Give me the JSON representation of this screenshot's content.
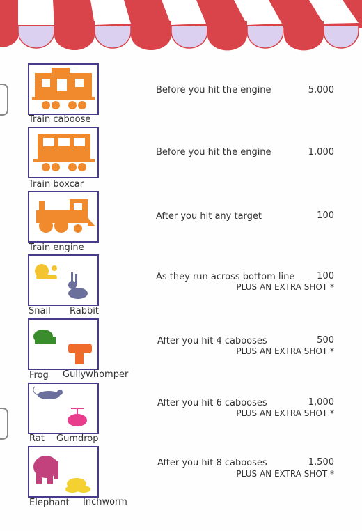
{
  "colors": {
    "awning_red": "#d9434a",
    "awning_lavender": "#dcd0f0",
    "box_border": "#4a3a8c",
    "train": "#f08a2c"
  },
  "rows": [
    {
      "labels": [
        "Train caboose"
      ],
      "description": "Before you hit the engine",
      "points": "5,000",
      "extra": ""
    },
    {
      "labels": [
        "Train boxcar"
      ],
      "description": "Before you hit the engine",
      "points": "1,000",
      "extra": ""
    },
    {
      "labels": [
        "Train engine"
      ],
      "description": "After you hit any target",
      "points": "100",
      "extra": ""
    },
    {
      "labels": [
        "Snail",
        "Rabbit"
      ],
      "description": "As they run across bottom line",
      "points": "100",
      "extra": "PLUS AN EXTRA SHOT *"
    },
    {
      "labels": [
        "Frog",
        "Gullywhomper"
      ],
      "description": "After you hit 4 cabooses",
      "points": "500",
      "extra": "PLUS AN EXTRA SHOT *"
    },
    {
      "labels": [
        "Rat",
        "Gumdrop"
      ],
      "description": "After you hit 6 cabooses",
      "points": "1,000",
      "extra": "PLUS AN EXTRA SHOT *"
    },
    {
      "labels": [
        "Elephant",
        "Inchworm"
      ],
      "description": "After you hit 8 cabooses",
      "points": "1,500",
      "extra": "PLUS AN EXTRA SHOT *"
    }
  ]
}
